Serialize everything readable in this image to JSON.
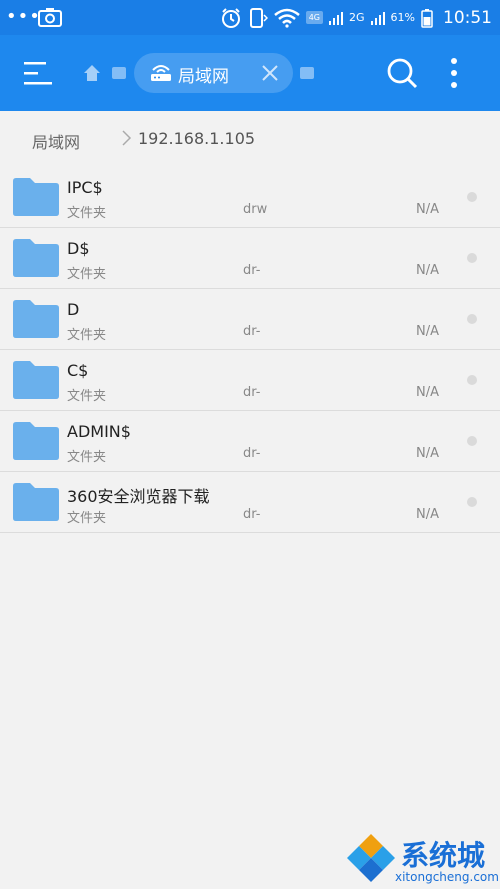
{
  "status_bar": {
    "battery_percent": "61%",
    "network": "4G",
    "network2": "2G",
    "time": "10:51"
  },
  "app_bar": {
    "active_tab_label": "局域网"
  },
  "breadcrumb": {
    "root": "局域网",
    "current": "192.168.1.105"
  },
  "files": [
    {
      "name": "IPC$",
      "type": "文件夹",
      "perm": "drw",
      "size": "N/A"
    },
    {
      "name": "D$",
      "type": "文件夹",
      "perm": "dr-",
      "size": "N/A"
    },
    {
      "name": "D",
      "type": "文件夹",
      "perm": "dr-",
      "size": "N/A"
    },
    {
      "name": "C$",
      "type": "文件夹",
      "perm": "dr-",
      "size": "N/A"
    },
    {
      "name": "ADMIN$",
      "type": "文件夹",
      "perm": "dr-",
      "size": "N/A"
    },
    {
      "name": "360安全浏览器下载",
      "type": "文件夹",
      "perm": "dr-",
      "size": "N/A"
    }
  ],
  "watermark": {
    "title": "系统城",
    "url": "xitongcheng.com"
  },
  "colors": {
    "app_bar": "#1e88ee",
    "status_bar": "#1a7ee6",
    "folder": "#6ab0ec",
    "background": "#f2f2f2"
  }
}
